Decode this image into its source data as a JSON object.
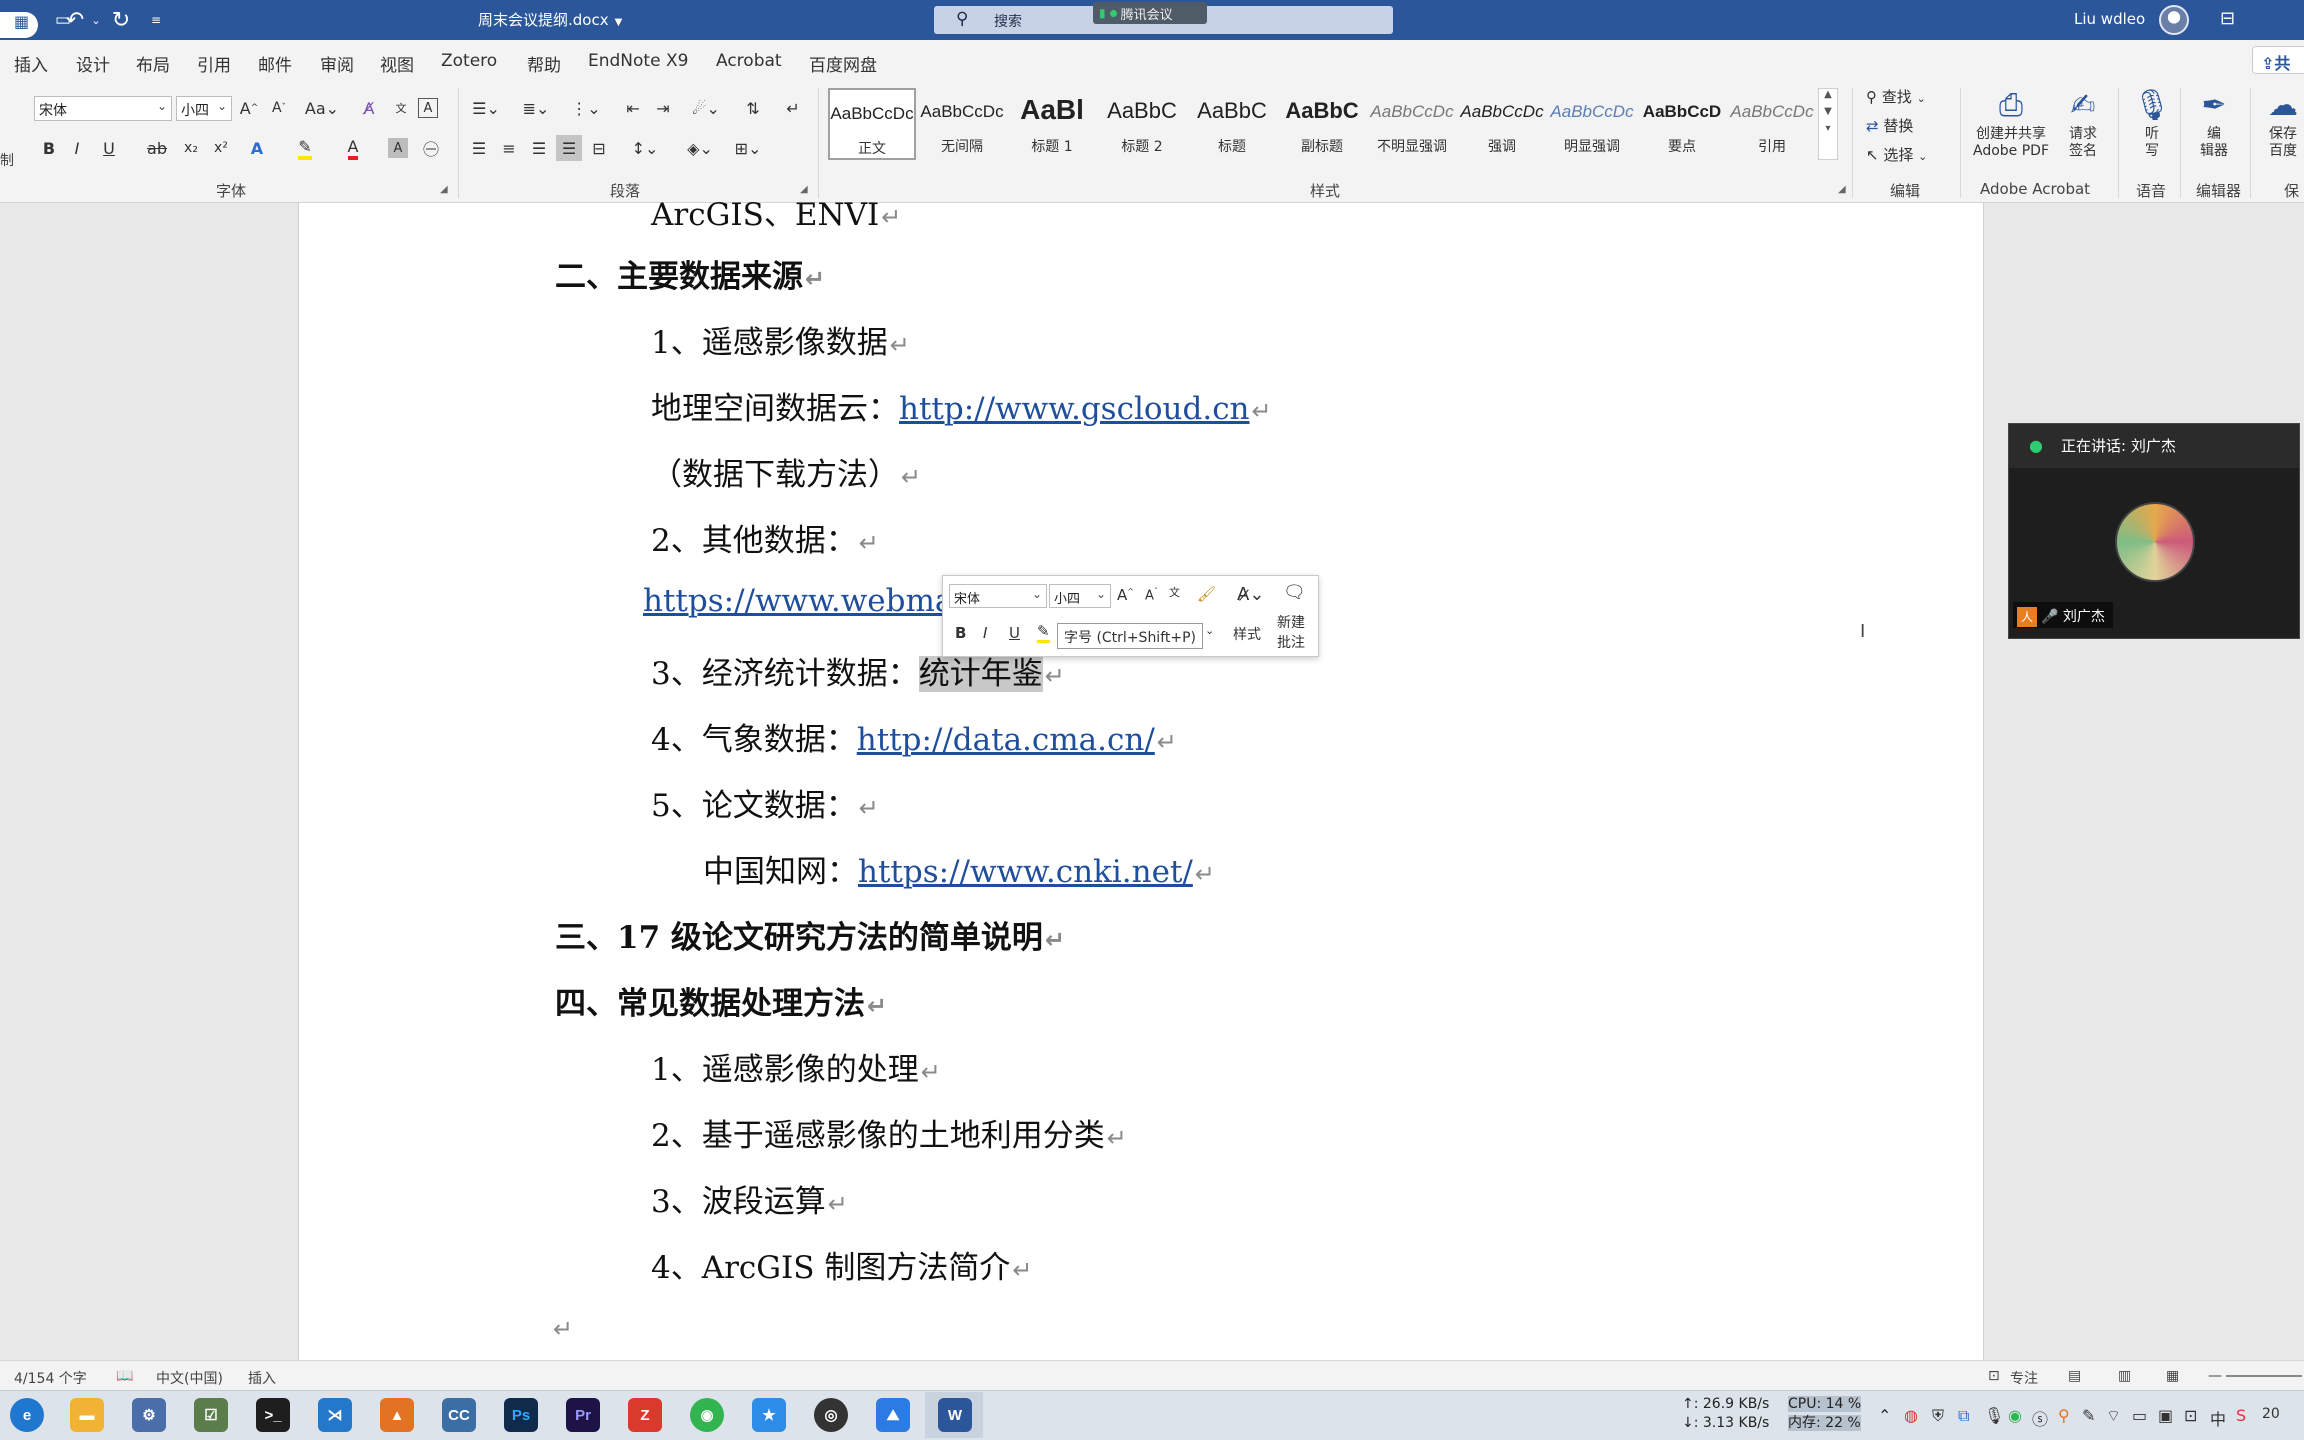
{
  "titlebar": {
    "doc_title": "周末会议提纲.docx",
    "search_placeholder": "搜索",
    "meeting_chip": "腾讯会议",
    "user_name": "Liu wdleo"
  },
  "tabs": [
    "插入",
    "设计",
    "布局",
    "引用",
    "邮件",
    "审阅",
    "视图",
    "Zotero",
    "帮助",
    "EndNote X9",
    "Acrobat",
    "百度网盘"
  ],
  "share_label": "共",
  "ribbon": {
    "font_name": "宋体",
    "font_size": "小四",
    "group_font": "字体",
    "group_paragraph": "段落",
    "group_styles": "样式",
    "group_edit": "编辑",
    "group_acrobat": "Adobe Acrobat",
    "group_voice": "语音",
    "group_editor": "编辑器",
    "group_save": "保",
    "left_edge_label": "制",
    "styles": [
      {
        "sample": "AaBbCcDc",
        "name": "正文"
      },
      {
        "sample": "AaBbCcDc",
        "name": "无间隔"
      },
      {
        "sample": "AaBl",
        "name": "标题 1"
      },
      {
        "sample": "AaBbC",
        "name": "标题 2"
      },
      {
        "sample": "AaBbC",
        "name": "标题"
      },
      {
        "sample": "AaBbC",
        "name": "副标题"
      },
      {
        "sample": "AaBbCcDc",
        "name": "不明显强调"
      },
      {
        "sample": "AaBbCcDc",
        "name": "强调"
      },
      {
        "sample": "AaBbCcDc",
        "name": "明显强调"
      },
      {
        "sample": "AaBbCcD",
        "name": "要点"
      },
      {
        "sample": "AaBbCcDc",
        "name": "引用"
      }
    ],
    "find": "查找",
    "replace": "替换",
    "select": "选择",
    "create_pdf_1": "创建并共享",
    "create_pdf_2": "Adobe PDF",
    "sign_1": "请求",
    "sign_2": "签名",
    "dictate_1": "听",
    "dictate_2": "写",
    "editor_1": "编",
    "editor_2": "辑器",
    "save_baidu_1": "保存",
    "save_baidu_2": "百度"
  },
  "document": {
    "lines": [
      {
        "text": "ArcGIS、ENVI",
        "mark": "↵"
      },
      {
        "text": "二、主要数据来源",
        "mark": "↵"
      },
      {
        "text": "1、遥感影像数据",
        "mark": "↵"
      },
      {
        "text": "地理空间数据云：",
        "link": "http://www.gscloud.cn",
        "mark": "↵"
      },
      {
        "text": "（数据下载方法）",
        "mark": "↵"
      },
      {
        "text": "2、其他数据：",
        "mark": "↵"
      },
      {
        "link": "https://www.webmap.c"
      },
      {
        "text": "3、经济统计数据：",
        "highlight": "统计年鉴",
        "mark": "↵"
      },
      {
        "text": "4、气象数据：",
        "link": "http://data.cma.cn/",
        "mark": "↵"
      },
      {
        "text": "5、论文数据：",
        "mark": "↵"
      },
      {
        "text": "中国知网：",
        "link": "https://www.cnki.net/",
        "mark": "↵"
      },
      {
        "text": "三、17 级论文研究方法的简单说明",
        "mark": "↵"
      },
      {
        "text": "四、常见数据处理方法",
        "mark": "↵"
      },
      {
        "text": "1、遥感影像的处理",
        "mark": "↵"
      },
      {
        "text": "2、基于遥感影像的土地利用分类",
        "mark": "↵"
      },
      {
        "text": "3、波段运算",
        "mark": "↵"
      },
      {
        "text": "4、ArcGIS  制图方法简介",
        "mark": "↵"
      },
      {
        "mark": "↵"
      }
    ]
  },
  "mini_toolbar": {
    "font_name": "宋体",
    "font_size": "小四",
    "styles_label": "样式",
    "new_comment_1": "新建",
    "new_comment_2": "批注",
    "tooltip": "字号 (Ctrl+Shift+P)"
  },
  "meeting": {
    "speaking": "正在讲话: 刘广杰",
    "participant": "刘广杰"
  },
  "statusbar": {
    "word_count": "4/154 个字",
    "language": "中文(中国)",
    "mode": "插入",
    "focus": "专注"
  },
  "taskbar": {
    "net_up": "↑: 26.9 KB/s",
    "net_down": "↓: 3.13 KB/s",
    "cpu": "CPU: 14 %",
    "mem": "内存: 22 %",
    "ime": "中",
    "clock_fragment": "20"
  }
}
